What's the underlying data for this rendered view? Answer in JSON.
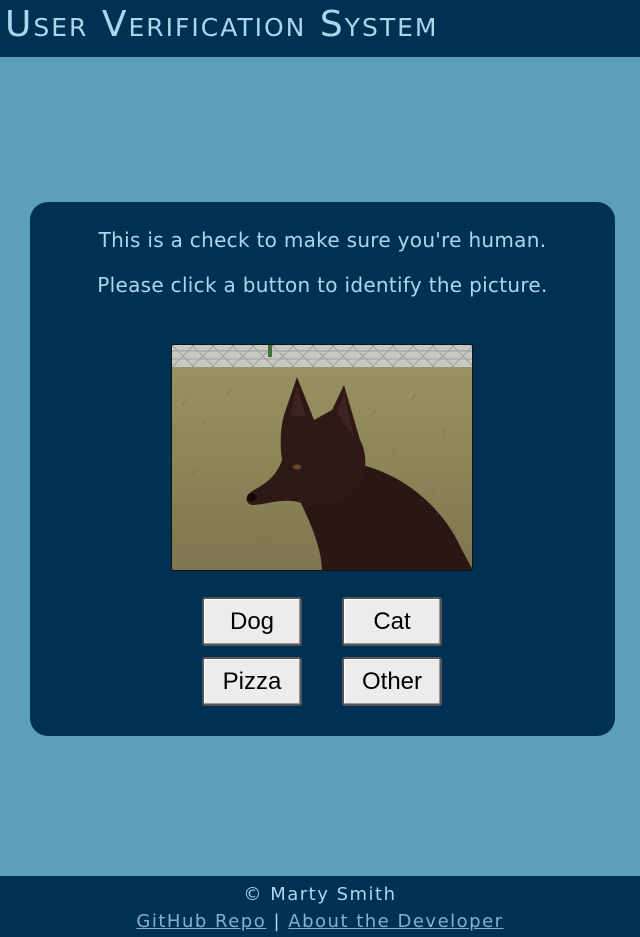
{
  "header": {
    "title": "User Verification System"
  },
  "prompt": {
    "line1": "This is a check to make sure you're human.",
    "line2": "Please click a button to identify the picture."
  },
  "image": {
    "subject_icon": "dog-photo"
  },
  "choices": [
    {
      "label": "Dog"
    },
    {
      "label": "Cat"
    },
    {
      "label": "Pizza"
    },
    {
      "label": "Other"
    }
  ],
  "footer": {
    "copyright": "© Marty Smith",
    "link_github": "GitHub Repo",
    "separator": "|",
    "link_about": "About the Developer"
  },
  "colors": {
    "page_background": "#5b9fbc",
    "panel_background": "#003153",
    "text_accent": "#a9d8ee",
    "link": "#7fb3cf"
  }
}
